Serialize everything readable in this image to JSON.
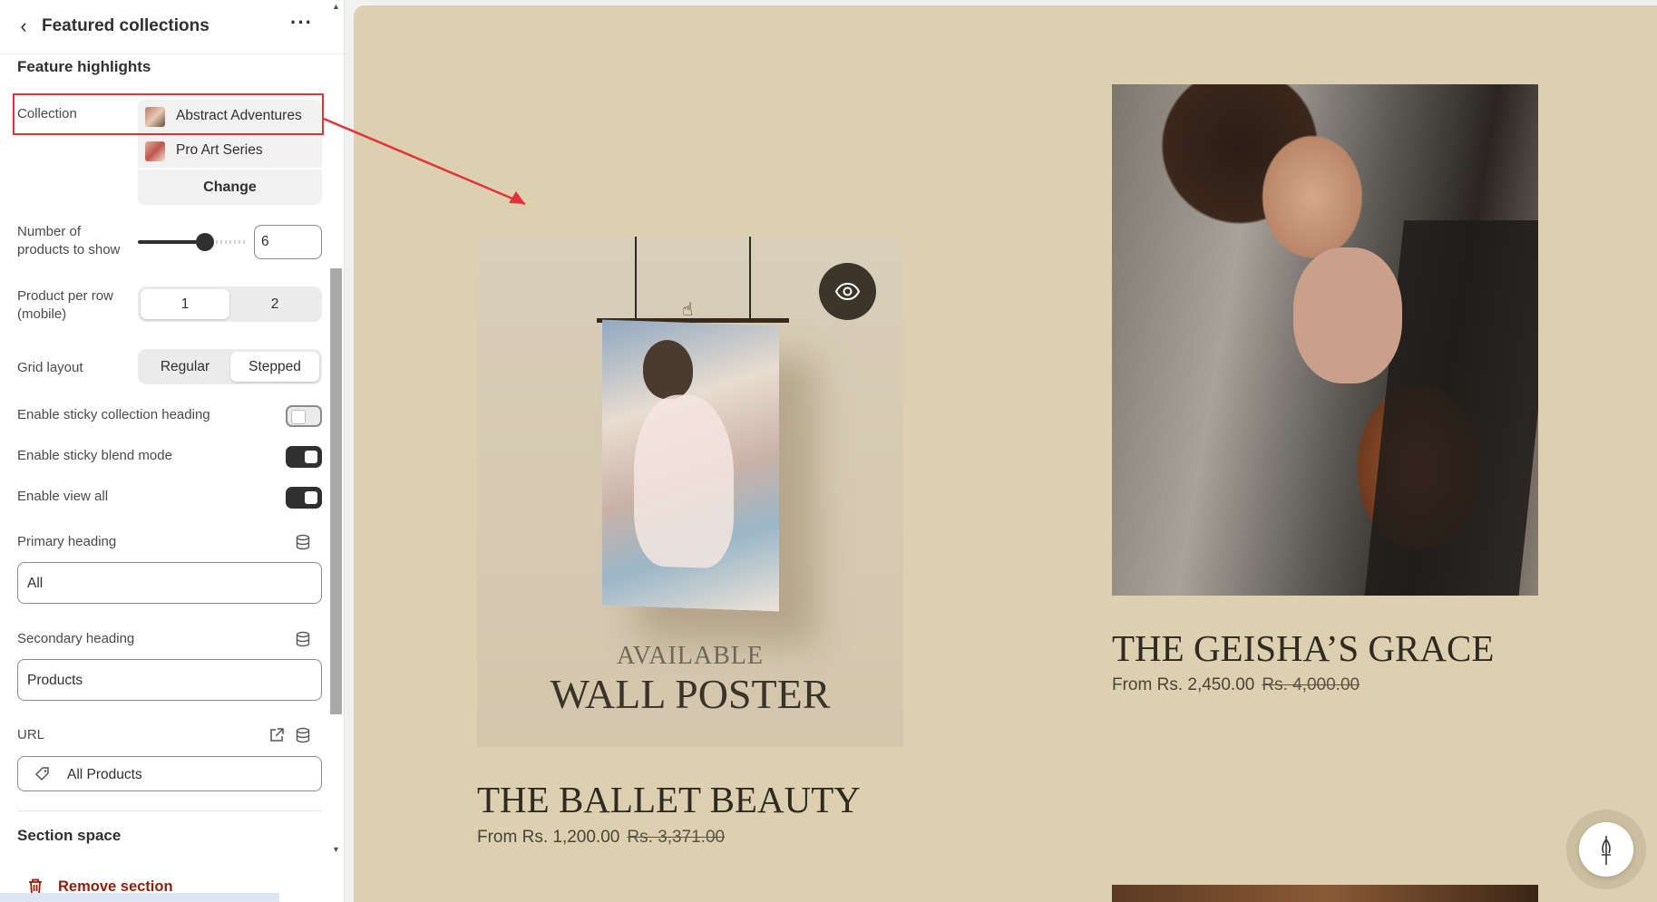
{
  "header": {
    "title": "Featured collections"
  },
  "feature": {
    "title": "Feature highlights",
    "collection_label": "Collection",
    "collections": [
      "Abstract Adventures",
      "Pro Art Series"
    ],
    "change_label": "Change"
  },
  "products_count": {
    "label": "Number of products to show",
    "value": "6",
    "slider_fraction": 0.6
  },
  "per_row": {
    "label": "Product per row (mobile)",
    "options": [
      "1",
      "2"
    ],
    "selected": "1"
  },
  "grid": {
    "label": "Grid layout",
    "options": [
      "Regular",
      "Stepped"
    ],
    "selected": "Stepped"
  },
  "toggles": [
    {
      "label": "Enable sticky collection heading",
      "on": false
    },
    {
      "label": "Enable sticky blend mode",
      "on": true
    },
    {
      "label": "Enable view all",
      "on": true
    }
  ],
  "primary_heading": {
    "label": "Primary heading",
    "value": "All"
  },
  "secondary_heading": {
    "label": "Secondary heading",
    "value": "Products"
  },
  "url": {
    "label": "URL",
    "value": "All Products"
  },
  "section_space": {
    "title": "Section space"
  },
  "remove_label": "Remove section",
  "preview": {
    "card1": {
      "poster_sub": "AVAILABLE",
      "poster_main": "WALL POSTER",
      "title": "THE BALLET BEAUTY",
      "price": "From Rs. 1,200.00",
      "compare_price": "Rs. 3,371.00"
    },
    "card2": {
      "title": "THE GEISHA’S GRACE",
      "price": "From Rs. 2,450.00",
      "compare_price": "Rs. 4,000.00"
    }
  },
  "colors": {
    "preview_bg": "#ddd0b1",
    "highlight_red": "#e2333b",
    "danger": "#8e1f0b",
    "toggle_on": "#303030"
  }
}
